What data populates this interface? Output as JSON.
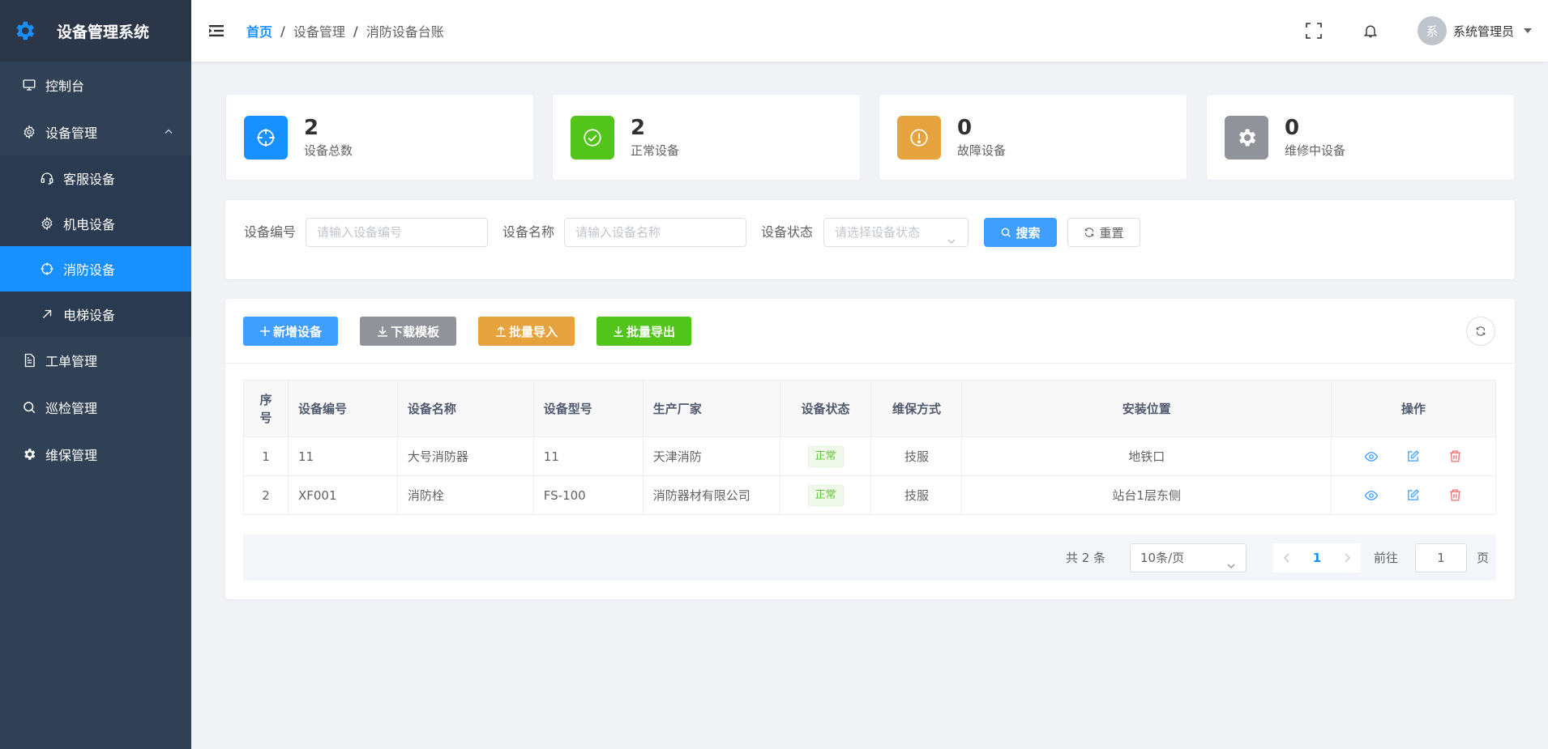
{
  "app": {
    "title": "设备管理系统"
  },
  "sidebar": {
    "items": [
      {
        "label": "控制台",
        "icon": "monitor-icon"
      },
      {
        "label": "设备管理",
        "icon": "gear-icon",
        "expanded": true
      },
      {
        "label": "客服设备",
        "icon": "headset-icon",
        "sub": true
      },
      {
        "label": "机电设备",
        "icon": "gear-icon",
        "sub": true
      },
      {
        "label": "消防设备",
        "icon": "target-icon",
        "sub": true,
        "active": true
      },
      {
        "label": "电梯设备",
        "icon": "arrow-up-right-icon",
        "sub": true
      },
      {
        "label": "工单管理",
        "icon": "document-icon"
      },
      {
        "label": "巡检管理",
        "icon": "search-icon"
      },
      {
        "label": "维保管理",
        "icon": "gear-solid-icon"
      }
    ]
  },
  "header": {
    "breadcrumb": [
      "首页",
      "设备管理",
      "消防设备台账"
    ],
    "avatar_text": "系",
    "username": "系统管理员"
  },
  "stats": [
    {
      "value": "2",
      "label": "设备总数",
      "color": "#1890ff",
      "icon": "target-icon"
    },
    {
      "value": "2",
      "label": "正常设备",
      "color": "#52c41a",
      "icon": "check-circle-icon"
    },
    {
      "value": "0",
      "label": "故障设备",
      "color": "#e6a23c",
      "icon": "warning-circle-icon"
    },
    {
      "value": "0",
      "label": "维修中设备",
      "color": "#909399",
      "icon": "gear-solid-icon"
    }
  ],
  "search": {
    "code_label": "设备编号",
    "code_placeholder": "请输入设备编号",
    "name_label": "设备名称",
    "name_placeholder": "请输入设备名称",
    "status_label": "设备状态",
    "status_placeholder": "请选择设备状态",
    "search_btn": "搜索",
    "reset_btn": "重置"
  },
  "toolbar": {
    "add": "新增设备",
    "template": "下载模板",
    "import": "批量导入",
    "export": "批量导出"
  },
  "table": {
    "headers": [
      "序号",
      "设备编号",
      "设备名称",
      "设备型号",
      "生产厂家",
      "设备状态",
      "维保方式",
      "安装位置",
      "操作"
    ],
    "rows": [
      {
        "no": "1",
        "code": "11",
        "name": "大号消防器",
        "model": "11",
        "maker": "天津消防",
        "status": "正常",
        "maint": "技服",
        "location": "地铁口"
      },
      {
        "no": "2",
        "code": "XF001",
        "name": "消防栓",
        "model": "FS-100",
        "maker": "消防器材有限公司",
        "status": "正常",
        "maint": "技服",
        "location": "站台1层东侧"
      }
    ]
  },
  "pagination": {
    "total": "共 2 条",
    "page_size": "10条/页",
    "current": "1",
    "goto_label": "前往",
    "goto_value": "1",
    "page_suffix": "页"
  }
}
